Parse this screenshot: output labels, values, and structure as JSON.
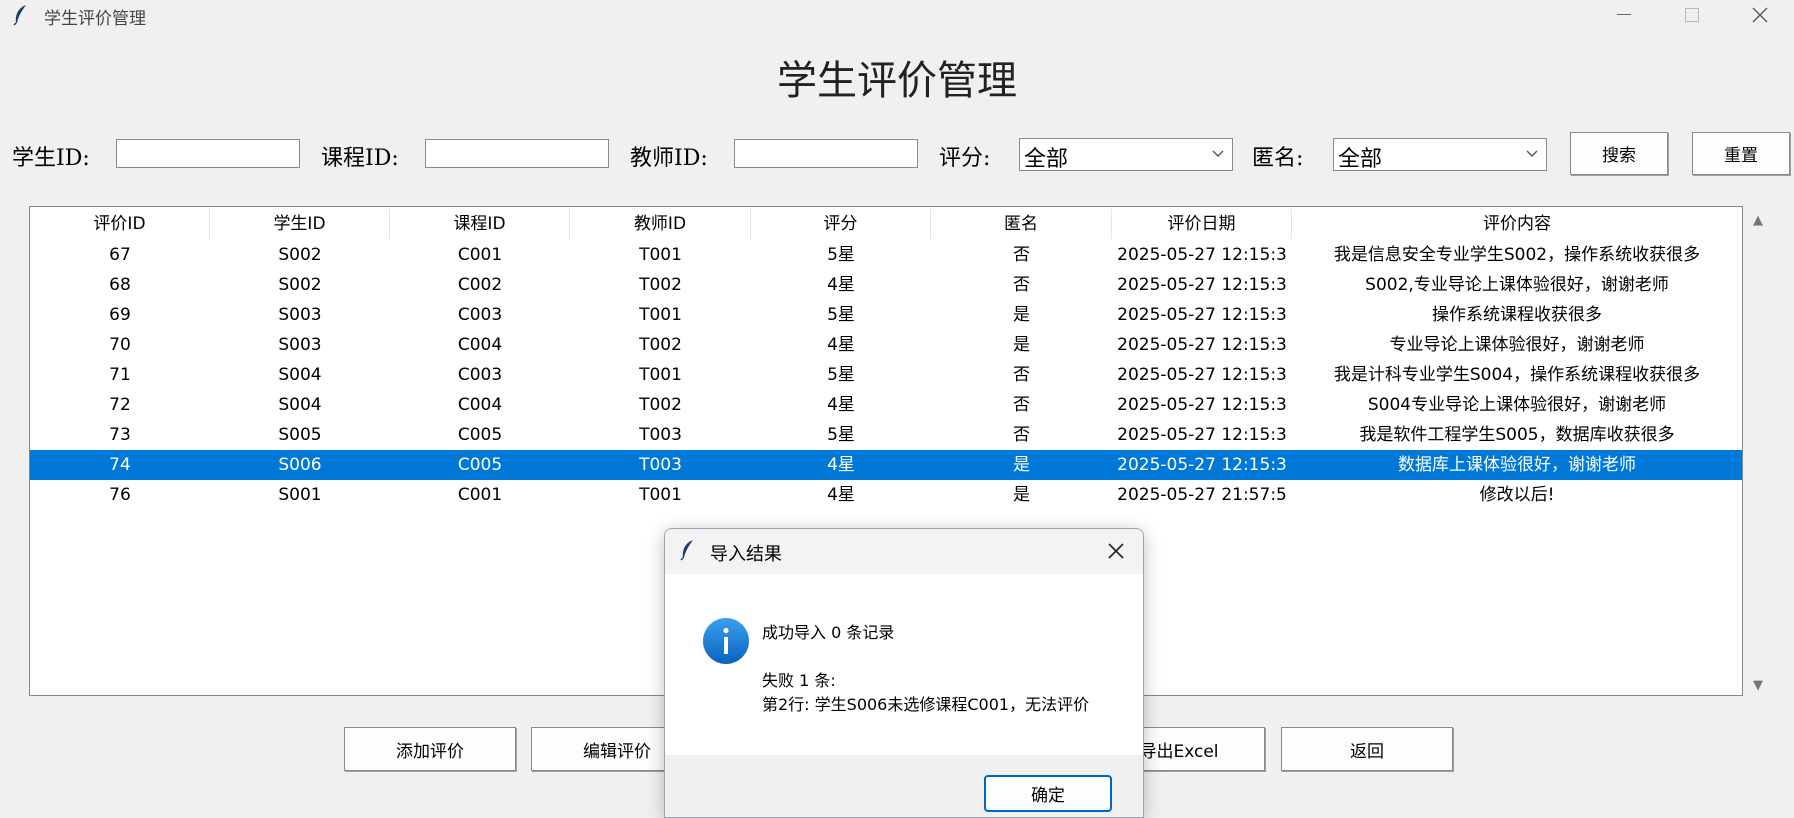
{
  "window": {
    "title": "学生评价管理",
    "icon": "feather-icon"
  },
  "heading": "学生评价管理",
  "filters": {
    "student_label": "学生ID:",
    "student_value": "",
    "course_label": "课程ID:",
    "course_value": "",
    "teacher_label": "教师ID:",
    "teacher_value": "",
    "rating_label": "评分:",
    "rating_selected": "全部",
    "anon_label": "匿名:",
    "anon_selected": "全部",
    "search_button": "搜索",
    "reset_button": "重置"
  },
  "table": {
    "headers": [
      "评价ID",
      "学生ID",
      "课程ID",
      "教师ID",
      "评分",
      "匿名",
      "评价日期",
      "评价内容"
    ],
    "rows": [
      [
        "67",
        "S002",
        "C001",
        "T001",
        "5星",
        "否",
        "2025-05-27 12:15:3",
        "我是信息安全专业学生S002，操作系统收获很多"
      ],
      [
        "68",
        "S002",
        "C002",
        "T002",
        "4星",
        "否",
        "2025-05-27 12:15:3",
        "S002,专业导论上课体验很好，谢谢老师"
      ],
      [
        "69",
        "S003",
        "C003",
        "T001",
        "5星",
        "是",
        "2025-05-27 12:15:3",
        "操作系统课程收获很多"
      ],
      [
        "70",
        "S003",
        "C004",
        "T002",
        "4星",
        "是",
        "2025-05-27 12:15:3",
        "专业导论上课体验很好，谢谢老师"
      ],
      [
        "71",
        "S004",
        "C003",
        "T001",
        "5星",
        "否",
        "2025-05-27 12:15:3",
        "我是计科专业学生S004，操作系统课程收获很多"
      ],
      [
        "72",
        "S004",
        "C004",
        "T002",
        "4星",
        "否",
        "2025-05-27 12:15:3",
        "S004专业导论上课体验很好，谢谢老师"
      ],
      [
        "73",
        "S005",
        "C005",
        "T003",
        "5星",
        "否",
        "2025-05-27 12:15:3",
        "我是软件工程学生S005，数据库收获很多"
      ],
      [
        "74",
        "S006",
        "C005",
        "T003",
        "4星",
        "是",
        "2025-05-27 12:15:3",
        "数据库上课体验很好，谢谢老师"
      ],
      [
        "76",
        "S001",
        "C001",
        "T001",
        "4星",
        "是",
        "2025-05-27 21:57:5",
        "修改以后!"
      ]
    ],
    "selected_row": 7
  },
  "actions": {
    "add": "添加评价",
    "edit": "编辑评价",
    "export": "导出Excel",
    "back": "返回"
  },
  "dialog": {
    "title": "导入结果",
    "line1": "成功导入 0 条记录",
    "line2": "失败 1 条:",
    "line3": "第2行: 学生S006未选修课程C001，无法评价",
    "ok": "确定",
    "icon": "info-icon"
  },
  "colors": {
    "selection": "#0078d7",
    "info": "#1a7fd4",
    "background": "#f0f0f0"
  }
}
